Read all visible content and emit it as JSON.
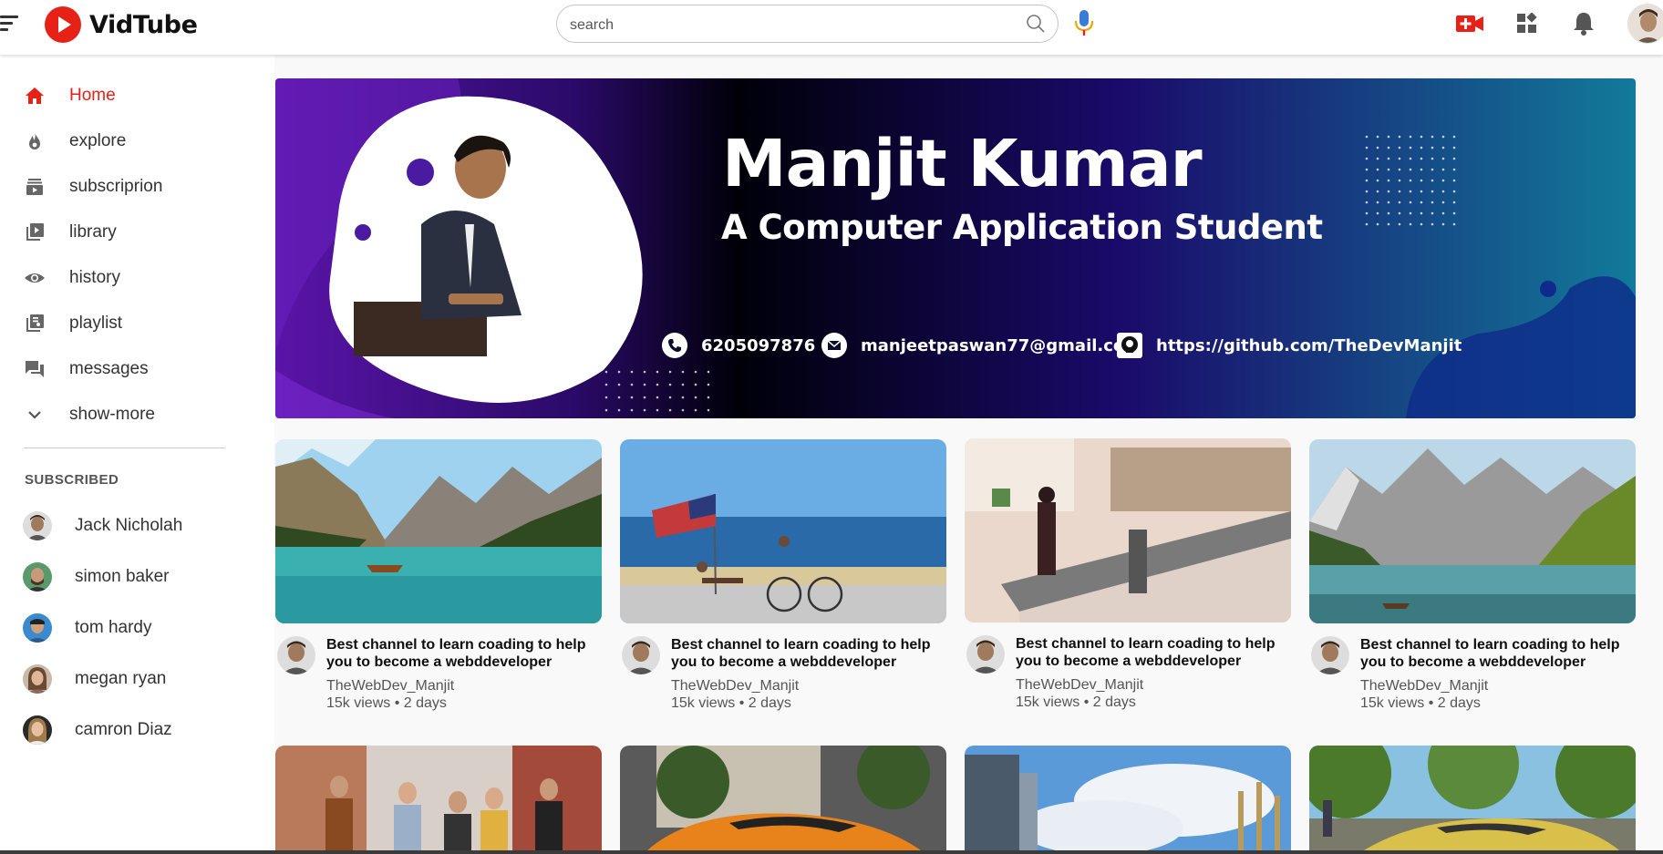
{
  "app": {
    "name": "VidTube",
    "brand_color": "#e62117"
  },
  "search": {
    "placeholder": "search"
  },
  "sidebar": {
    "items": [
      {
        "label": "Home",
        "icon": "home-icon",
        "active": true
      },
      {
        "label": "explore",
        "icon": "flame-icon"
      },
      {
        "label": "subscriprion",
        "icon": "subscriptions-icon"
      },
      {
        "label": "library",
        "icon": "library-icon"
      },
      {
        "label": "history",
        "icon": "eye-icon"
      },
      {
        "label": "playlist",
        "icon": "playlist-icon"
      },
      {
        "label": "messages",
        "icon": "chat-icon"
      },
      {
        "label": "show-more",
        "icon": "chevron-down-icon"
      }
    ],
    "subscribed_title": "SUBSCRIBED",
    "subscriptions": [
      {
        "name": "Jack Nicholah"
      },
      {
        "name": "simon baker"
      },
      {
        "name": "tom hardy"
      },
      {
        "name": "megan ryan"
      },
      {
        "name": "camron Diaz"
      }
    ]
  },
  "banner": {
    "name": "Manjit Kumar",
    "subtitle": "A Computer Application Student",
    "phone": "6205097876",
    "email": "manjeetpaswan77@gmail.com",
    "github": "https://github.com/TheDevManjit"
  },
  "videos": [
    {
      "title": "Best channel to learn coading to help you to become a webddeveloper",
      "channel": "TheWebDev_Manjit",
      "meta": "15k views • 2 days",
      "thumb": "lake-with-boat"
    },
    {
      "title": "Best channel to learn coading to help you to become a webddeveloper",
      "channel": "TheWebDev_Manjit",
      "meta": "15k views • 2 days",
      "thumb": "beach-flag-bicycle"
    },
    {
      "title": "Best channel to learn coading to help you to become a webddeveloper",
      "channel": "TheWebDev_Manjit",
      "meta": "15k views • 2 days",
      "thumb": "mall-escalator"
    },
    {
      "title": "Best channel to learn coading to help you to become a webddeveloper",
      "channel": "TheWebDev_Manjit",
      "meta": "15k views • 2 days",
      "thumb": "mountain-lake"
    },
    {
      "thumb": "friends-street"
    },
    {
      "thumb": "orange-sports-car"
    },
    {
      "thumb": "building-sky"
    },
    {
      "thumb": "yellow-sports-car"
    }
  ]
}
